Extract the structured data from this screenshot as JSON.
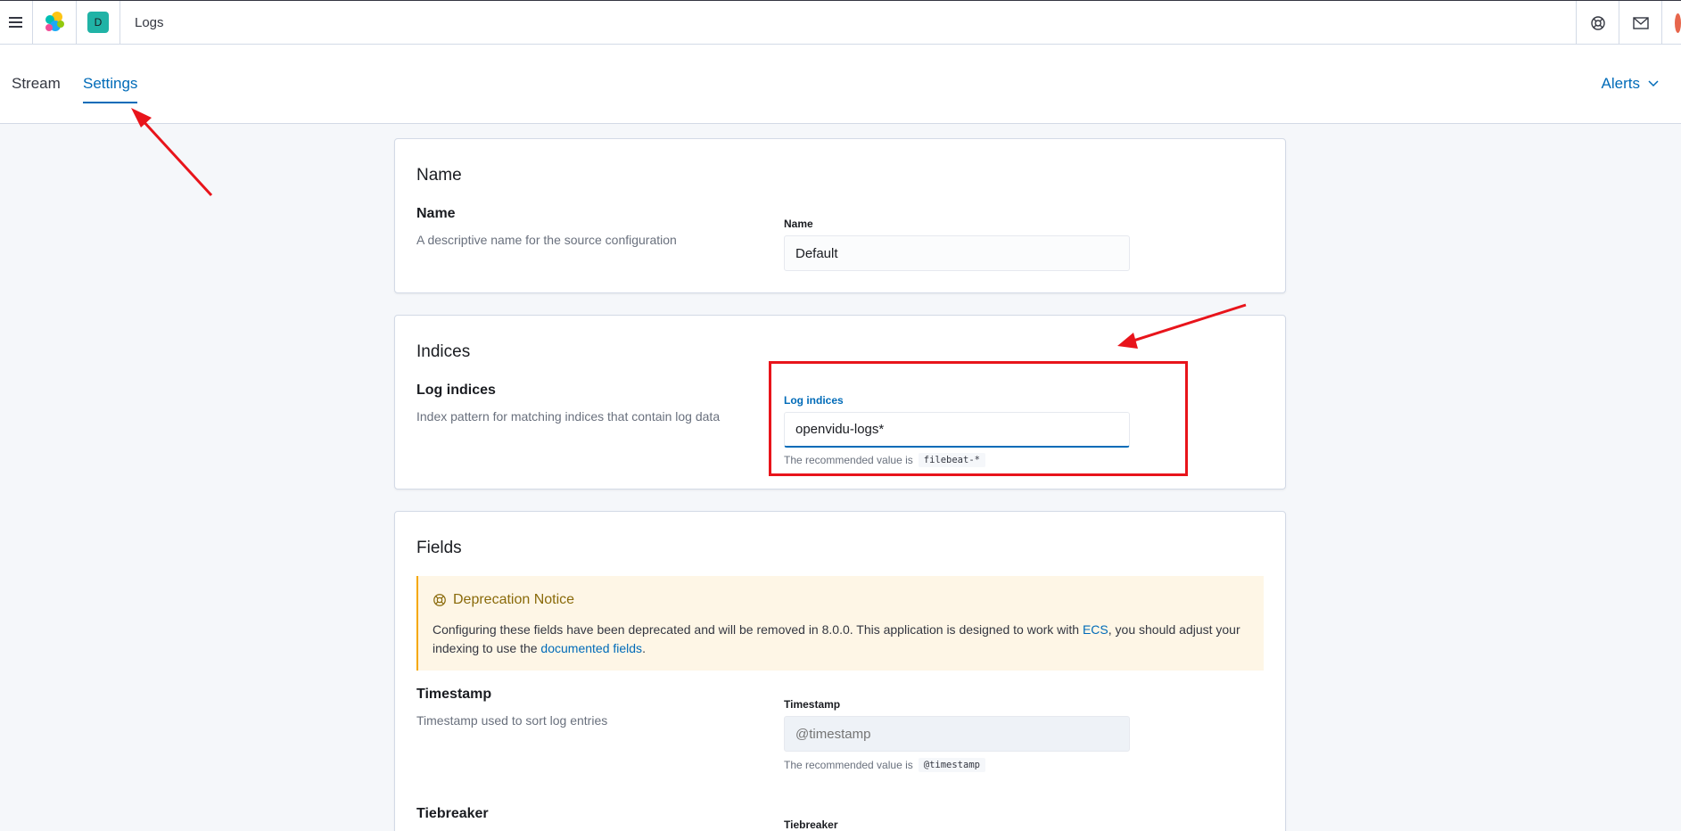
{
  "header": {
    "space_initial": "D",
    "page_title": "Logs",
    "icons": [
      "menu-icon",
      "elastic-logo-icon",
      "help-icon",
      "newsfeed-icon",
      "user-avatar"
    ]
  },
  "tabs": {
    "stream": "Stream",
    "settings": "Settings",
    "alerts": "Alerts"
  },
  "name_panel": {
    "title": "Name",
    "row_title": "Name",
    "row_desc": "A descriptive name for the source configuration",
    "field_label": "Name",
    "field_value": "Default"
  },
  "indices_panel": {
    "title": "Indices",
    "row_title": "Log indices",
    "row_desc": "Index pattern for matching indices that contain log data",
    "field_label": "Log indices",
    "field_value": "openvidu-logs*",
    "help_prefix": "The recommended value is",
    "help_code": "filebeat-*"
  },
  "fields_panel": {
    "title": "Fields",
    "notice": {
      "title": "Deprecation Notice",
      "text_1": "Configuring these fields have been deprecated and will be removed in 8.0.0. This application is designed to work with ",
      "link_ecs": "ECS",
      "text_2": ", you should adjust your indexing to use the ",
      "link_docs": "documented fields",
      "text_3": "."
    },
    "timestamp": {
      "row_title": "Timestamp",
      "row_desc": "Timestamp used to sort log entries",
      "field_label": "Timestamp",
      "placeholder": "@timestamp",
      "help_prefix": "The recommended value is",
      "help_code": "@timestamp"
    },
    "tiebreaker": {
      "row_title": "Tiebreaker",
      "field_label": "Tiebreaker"
    }
  },
  "colors": {
    "accent": "#006bb8",
    "annotation": "#e8141b",
    "notice_bg": "#fef6e6",
    "notice_border": "#f5a700"
  }
}
